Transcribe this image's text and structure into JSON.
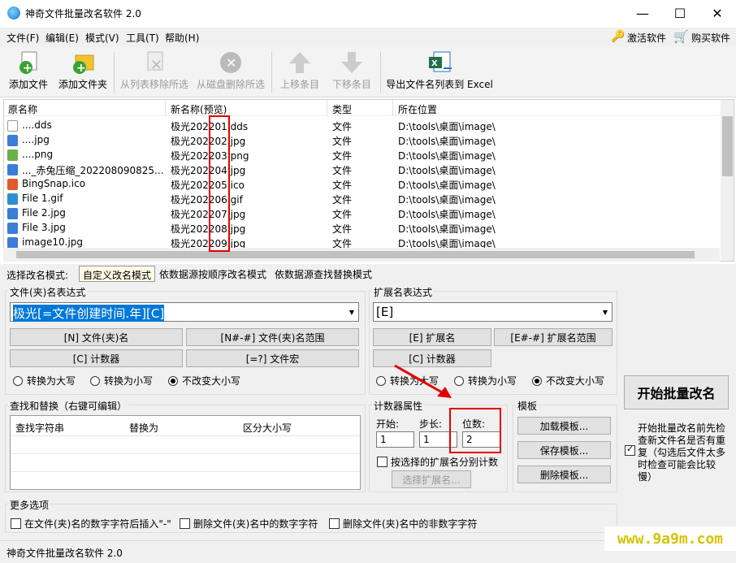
{
  "window": {
    "title": "神奇文件批量改名软件 2.0"
  },
  "menu": {
    "items": [
      "文件(F)",
      "编辑(E)",
      "模式(V)",
      "工具(T)",
      "帮助(H)"
    ],
    "activate": "激活软件",
    "buy": "购买软件"
  },
  "toolbar": {
    "add_file": "添加文件",
    "add_folder": "添加文件夹",
    "remove_from_list": "从列表移除所选",
    "delete_from_disk": "从磁盘删除所选",
    "move_up": "上移条目",
    "move_down": "下移条目",
    "export_excel": "导出文件名列表到 Excel"
  },
  "filelist": {
    "columns": [
      "原名称",
      "新名称(预览)",
      "类型",
      "所在位置"
    ],
    "rows": [
      {
        "icon": "dds",
        "orig": "....dds",
        "new": "极光20220​1.dds",
        "type": "文件",
        "path": "D:\\tools\\桌面\\image\\"
      },
      {
        "icon": "jpg",
        "orig": "....jpg",
        "new": "极光202202.jpg",
        "type": "文件",
        "path": "D:\\tools\\桌面\\image\\"
      },
      {
        "icon": "png",
        "orig": "....png",
        "new": "极光202203.png",
        "type": "文件",
        "path": "D:\\tools\\桌面\\image\\"
      },
      {
        "icon": "jpg",
        "orig": "..._赤兔压缩_202208090825...",
        "new": "极光202204.jpg",
        "type": "文件",
        "path": "D:\\tools\\桌面\\image\\"
      },
      {
        "icon": "ico",
        "orig": "BingSnap.ico",
        "new": "极光202205.ico",
        "type": "文件",
        "path": "D:\\tools\\桌面\\image\\"
      },
      {
        "icon": "gif",
        "orig": "File 1.gif",
        "new": "极光202206.gif",
        "type": "文件",
        "path": "D:\\tools\\桌面\\image\\"
      },
      {
        "icon": "jpg",
        "orig": "File 2.jpg",
        "new": "极光202207.jpg",
        "type": "文件",
        "path": "D:\\tools\\桌面\\image\\"
      },
      {
        "icon": "jpg",
        "orig": "File 3.jpg",
        "new": "极光202208.jpg",
        "type": "文件",
        "path": "D:\\tools\\桌面\\image\\"
      },
      {
        "icon": "jpg",
        "orig": "image10.jpg",
        "new": "极光202209.jpg",
        "type": "文件",
        "path": "D:\\tools\\桌面\\image\\"
      }
    ]
  },
  "modes": {
    "label": "选择改名模式:",
    "custom": "自定义改名模式",
    "by_order": "依数据源按顺序改名模式",
    "find_replace": "依数据源查找替换模式"
  },
  "name_expr": {
    "title": "文件(夹)名表达式",
    "value": "极光[=文件创建时间.年][C]",
    "btn_name": "[N] 文件(夹)名",
    "btn_range": "[N#-#] 文件(夹)名范围",
    "btn_counter": "[C] 计数器",
    "btn_macro": "[=?] 文件宏",
    "upper": "转换为大写",
    "lower": "转换为小写",
    "keep": "不改变大小写"
  },
  "ext_expr": {
    "title": "扩展名表达式",
    "value": "[E]",
    "btn_ext": "[E] 扩展名",
    "btn_range": "[E#-#] 扩展名范围",
    "btn_counter": "[C] 计数器",
    "upper": "转换为大写",
    "lower": "转换为小写",
    "keep": "不改变大小写"
  },
  "find_replace": {
    "title": "查找和替换（右键可编辑）",
    "col_find": "查找字符串",
    "col_replace": "替换为",
    "col_case": "区分大小写"
  },
  "counter": {
    "title": "计数器属性",
    "start_label": "开始:",
    "start": "1",
    "step_label": "步长:",
    "step": "1",
    "digits_label": "位数:",
    "digits": "2",
    "by_ext": "按选择的扩展名分别计数",
    "select_ext": "选择扩展名..."
  },
  "template": {
    "title": "模板",
    "load": "加载模板...",
    "save": "保存模板...",
    "delete": "删除模板..."
  },
  "start_button": "开始批量改名",
  "check_dup": "开始批量改名前先检查新文件名是否有重复（勾选后文件太多时检查可能会比较慢）",
  "more_options": {
    "title": "更多选项",
    "opt1": "在文件(夹)名的数字字符后插入\"-\"",
    "opt2": "删除文件(夹)名中的数字字符",
    "opt3": "删除文件(夹)名中的非数字字符"
  },
  "status": "神奇文件批量改名软件 2.0",
  "watermark": "www.9a9m.com"
}
